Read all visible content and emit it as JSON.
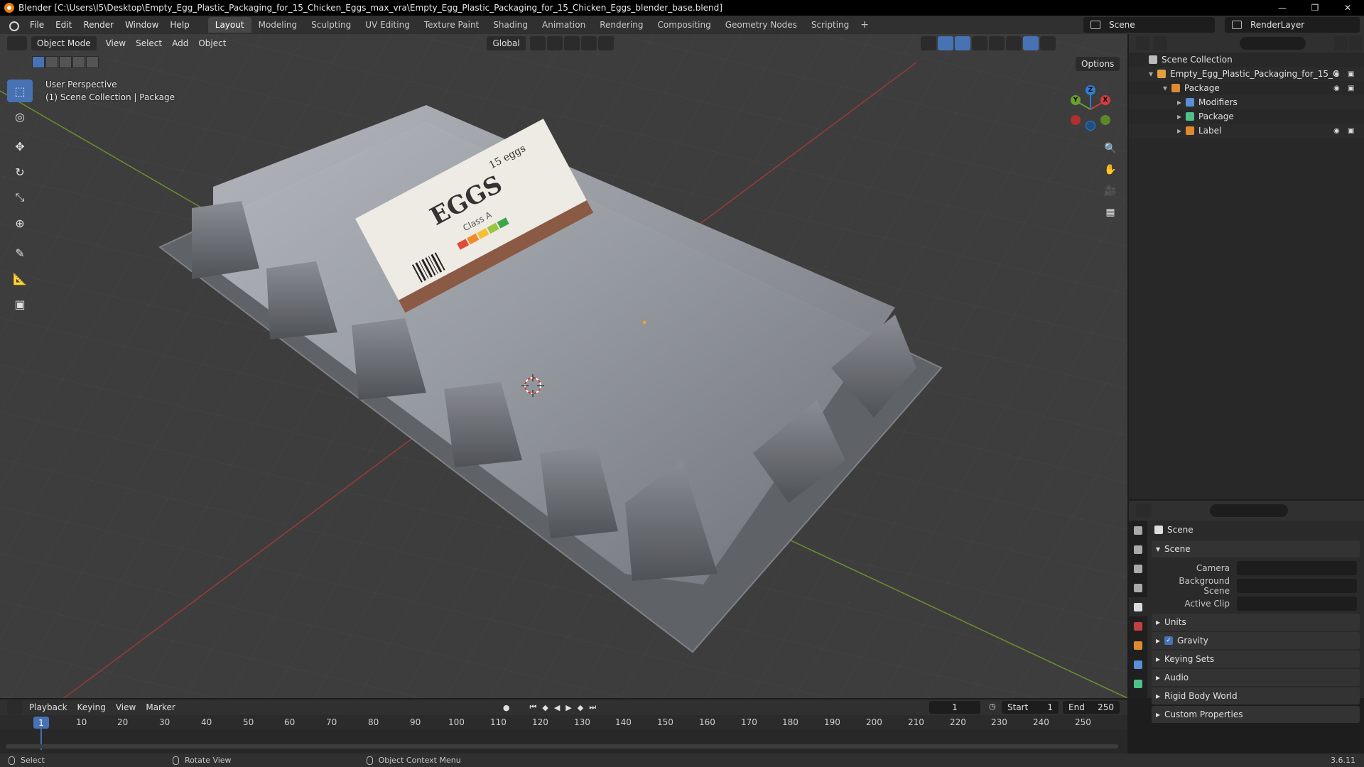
{
  "window": {
    "title": "Blender [C:\\Users\\I5\\Desktop\\Empty_Egg_Plastic_Packaging_for_15_Chicken_Eggs_max_vra\\Empty_Egg_Plastic_Packaging_for_15_Chicken_Eggs_blender_base.blend]",
    "minimize": "—",
    "maximize": "❐",
    "close": "✕"
  },
  "menu": {
    "file": "File",
    "edit": "Edit",
    "render": "Render",
    "window": "Window",
    "help": "Help"
  },
  "workspaces": [
    "Layout",
    "Modeling",
    "Sculpting",
    "UV Editing",
    "Texture Paint",
    "Shading",
    "Animation",
    "Rendering",
    "Compositing",
    "Geometry Nodes",
    "Scripting"
  ],
  "workspace_add": "+",
  "scene_selector": "Scene",
  "render_layer": "RenderLayer",
  "viewport": {
    "mode": "Object Mode",
    "view": "View",
    "select": "Select",
    "add": "Add",
    "object": "Object",
    "transform_orientation": "Global",
    "options": "Options",
    "perspective_label": "User Perspective",
    "collection_label": "(1) Scene Collection | Package",
    "label_text": {
      "title": "EGGS",
      "count": "15 eggs",
      "class": "Class A"
    },
    "gizmo": {
      "x": "X",
      "y": "Y",
      "z": "Z"
    }
  },
  "outliner": {
    "root": "Scene Collection",
    "items": [
      {
        "label": "Empty_Egg_Plastic_Packaging_for_15_C",
        "indent": 1
      },
      {
        "label": "Package",
        "indent": 2
      },
      {
        "label": "Modifiers",
        "indent": 3
      },
      {
        "label": "Package",
        "indent": 3
      },
      {
        "label": "Label",
        "indent": 3
      }
    ]
  },
  "properties": {
    "context": "Scene",
    "panel_scene": "Scene",
    "camera_label": "Camera",
    "background_scene_label": "Background Scene",
    "active_clip_label": "Active Clip",
    "panels": [
      "Units",
      "Gravity",
      "Keying Sets",
      "Audio",
      "Rigid Body World",
      "Custom Properties"
    ]
  },
  "timeline": {
    "playback": "Playback",
    "keying": "Keying",
    "view": "View",
    "marker": "Marker",
    "current_frame": "1",
    "start_label": "Start",
    "start_value": "1",
    "end_label": "End",
    "end_value": "250",
    "ruler": [
      "1",
      "10",
      "20",
      "30",
      "40",
      "50",
      "60",
      "70",
      "80",
      "90",
      "100",
      "110",
      "120",
      "130",
      "140",
      "150",
      "160",
      "170",
      "180",
      "190",
      "200",
      "210",
      "220",
      "230",
      "240",
      "250"
    ]
  },
  "status": {
    "select": "Select",
    "rotate_view": "Rotate View",
    "context_menu": "Object Context Menu",
    "version": "3.6.11"
  },
  "colors": {
    "accent": "#4772b3",
    "app_orange": "#e87d0d"
  }
}
